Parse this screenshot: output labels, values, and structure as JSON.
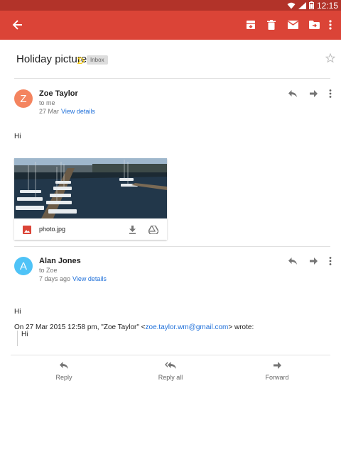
{
  "status_bar": {
    "time": "12:15"
  },
  "email": {
    "subject": "Holiday picture",
    "label": "Inbox"
  },
  "messages": [
    {
      "avatar_letter": "Z",
      "avatar_color": "#f4845f",
      "sender": "Zoe Taylor",
      "recipient": "to me",
      "date": "27 Mar",
      "details_link": "View details",
      "body": "Hi",
      "attachment": {
        "file_name": "photo.jpg"
      }
    },
    {
      "avatar_letter": "A",
      "avatar_color": "#4fc3f7",
      "sender": "Alan Jones",
      "recipient": "to Zoe",
      "date": "7 days ago",
      "details_link": "View details",
      "body": "Hi",
      "quote_header_prefix": "On 27 Mar 2015 12:58 pm, \"Zoe Taylor\" <",
      "quote_email": "zoe.taylor.wm@gmail.com",
      "quote_header_suffix": "> wrote:",
      "quote_body": "Hi"
    }
  ],
  "bottom_actions": {
    "reply": "Reply",
    "reply_all": "Reply all",
    "forward": "Forward"
  },
  "colors": {
    "toolbar": "#db4437",
    "status_bar": "#b23329",
    "link": "#1e6fd9"
  }
}
